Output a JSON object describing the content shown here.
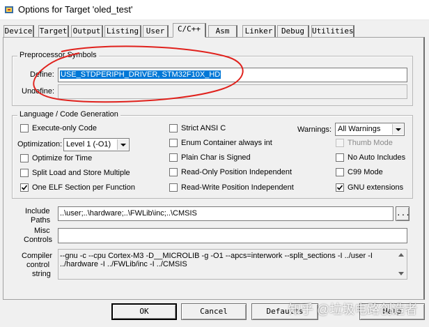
{
  "window": {
    "title": "Options for Target 'oled_test'"
  },
  "tabs": [
    {
      "label": "Device",
      "active": false
    },
    {
      "label": "Target",
      "active": false
    },
    {
      "label": "Output",
      "active": false
    },
    {
      "label": "Listing",
      "active": false
    },
    {
      "label": "User",
      "active": false
    },
    {
      "label": "C/C++",
      "active": true
    },
    {
      "label": "Asm",
      "active": false
    },
    {
      "label": "Linker",
      "active": false
    },
    {
      "label": "Debug",
      "active": false
    },
    {
      "label": "Utilities",
      "active": false
    }
  ],
  "preprocessor": {
    "group_title": "Preprocessor Symbols",
    "define_label": "Define:",
    "define_value": "USE_STDPERIPH_DRIVER, STM32F10X_HD",
    "undefine_label": "Undefine:",
    "undefine_value": ""
  },
  "language": {
    "group_title": "Language / Code Generation",
    "execute_only": {
      "label": "Execute-only Code",
      "checked": false
    },
    "optimization_label": "Optimization:",
    "optimization_value": "Level 1 (-O1)",
    "optimize_time": {
      "label": "Optimize for Time",
      "checked": false
    },
    "split_load": {
      "label": "Split Load and Store Multiple",
      "checked": false
    },
    "one_elf": {
      "label": "One ELF Section per Function",
      "checked": true
    },
    "strict_ansi": {
      "label": "Strict ANSI C",
      "checked": false
    },
    "enum_container": {
      "label": "Enum Container always int",
      "checked": false
    },
    "plain_char": {
      "label": "Plain Char is Signed",
      "checked": false
    },
    "ro_pi": {
      "label": "Read-Only Position Independent",
      "checked": false
    },
    "rw_pi": {
      "label": "Read-Write Position Independent",
      "checked": false
    },
    "warnings_label": "Warnings:",
    "warnings_value": "All Warnings",
    "thumb_mode": {
      "label": "Thumb Mode",
      "checked": false,
      "disabled": true
    },
    "no_auto_includes": {
      "label": "No Auto Includes",
      "checked": false
    },
    "c99_mode": {
      "label": "C99 Mode",
      "checked": false
    },
    "gnu_extensions": {
      "label": "GNU extensions",
      "checked": true
    }
  },
  "paths": {
    "include_label_1": "Include",
    "include_label_2": "Paths",
    "include_value": "..\\user;..\\hardware;..\\FWLib\\inc;..\\CMSIS",
    "browse_label": "...",
    "misc_label_1": "Misc",
    "misc_label_2": "Controls",
    "misc_value": "",
    "compiler_label_1": "Compiler",
    "compiler_label_2": "control",
    "compiler_label_3": "string",
    "compiler_line_1": "--gnu -c --cpu Cortex-M3 -D__MICROLIB -g -O1 --apcs=interwork --split_sections -I ../user -I",
    "compiler_line_2": "../hardware -I ../FWLib/inc -I ../CMSIS"
  },
  "buttons": {
    "ok": "OK",
    "cancel": "Cancel",
    "defaults": "Defaults",
    "help": "Help"
  },
  "watermark": "知乎 @垃圾电路创造者",
  "colors": {
    "selection": "#0078d7",
    "annotation": "#e0211c"
  }
}
